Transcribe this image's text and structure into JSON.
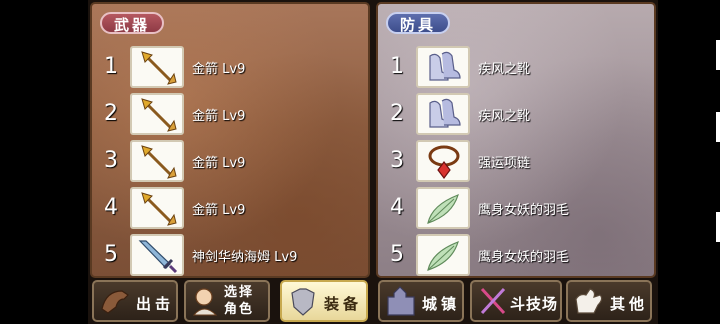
{
  "weapons": {
    "title": "武器",
    "items": [
      {
        "index": "1",
        "name": "金箭 Lv9",
        "icon": "golden-arrow-icon"
      },
      {
        "index": "2",
        "name": "金箭 Lv9",
        "icon": "golden-arrow-icon"
      },
      {
        "index": "3",
        "name": "金箭 Lv9",
        "icon": "golden-arrow-icon"
      },
      {
        "index": "4",
        "name": "金箭 Lv9",
        "icon": "golden-arrow-icon"
      },
      {
        "index": "5",
        "name": "神剑华纳海姆 Lv9",
        "icon": "sword-icon"
      }
    ]
  },
  "armor": {
    "title": "防具",
    "items": [
      {
        "index": "1",
        "name": "疾风之靴",
        "icon": "boots-icon"
      },
      {
        "index": "2",
        "name": "疾风之靴",
        "icon": "boots-icon"
      },
      {
        "index": "3",
        "name": "强运项链",
        "icon": "necklace-icon"
      },
      {
        "index": "4",
        "name": "鹰身女妖的羽毛",
        "icon": "feather-icon"
      },
      {
        "index": "5",
        "name": "鹰身女妖的羽毛",
        "icon": "feather-icon"
      }
    ]
  },
  "nav": {
    "sortie": "出击",
    "select_role_line1": "选择",
    "select_role_line2": "角色",
    "equipment": "装备",
    "town": "城镇",
    "arena": "斗技场",
    "other": "其他"
  }
}
